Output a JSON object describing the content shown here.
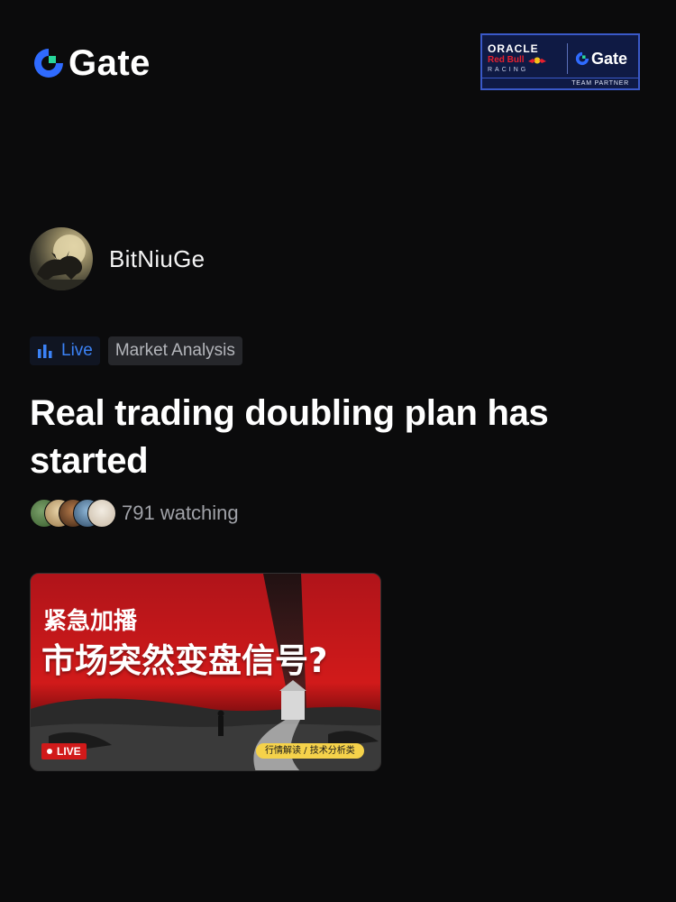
{
  "brand": {
    "name": "Gate",
    "accent": "#2f6bff",
    "icon": "gate-logo-icon"
  },
  "partner": {
    "oracle": "ORACLE",
    "redbull": "Red Bull",
    "racing": "RACING",
    "gate": "Gate",
    "team_partner": "TEAM PARTNER"
  },
  "author": {
    "name": "BitNiuGe",
    "avatar": "bull-moon-avatar"
  },
  "tags": {
    "live": "Live",
    "category": "Market Analysis"
  },
  "stream": {
    "title": "Real trading doubling plan has started",
    "watching": "791 watching",
    "viewer_count": 5
  },
  "thumbnail": {
    "subtitle": "紧急加播",
    "headline": "市场突然变盘信号?",
    "live_badge": "LIVE",
    "category_badge": "行情解读 / 技术分析类"
  },
  "colors": {
    "live_blue": "#3b82f6",
    "live_red": "#d11a1a",
    "badge_yellow": "#f5d24a"
  }
}
